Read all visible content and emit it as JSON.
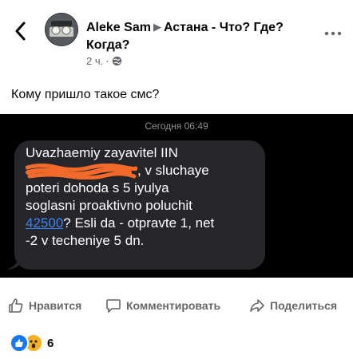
{
  "post": {
    "author": "Aleke Sam",
    "group": "Астана - Что? Где? Когда?",
    "time": "2 ч.",
    "dot": "·",
    "text": "Кому пришло такое смс?"
  },
  "sms": {
    "date": "Сегодня 06:49",
    "line1": "Uvazhaemiy zayavitel IIN",
    "line2_suffix": ", v sluchaye",
    "line3": "poteri dohoda s 5 iyulya",
    "line4": "soglasni proaktivno poluchit",
    "link_number": "42500",
    "line5_suffix": "? Esli da - otpravte 1, net",
    "line6": "-2 v techeniye 5 dn.",
    "redaction_color": "#f26a2a"
  },
  "actions": {
    "like": "Нравится",
    "comment": "Комментировать",
    "share": "Поделиться"
  },
  "reactions": {
    "count": "6",
    "types": [
      "like",
      "wow"
    ]
  },
  "icons": {
    "back": "chevron-left-icon",
    "more": "more-dots-icon",
    "globe": "globe-icon",
    "like": "thumbs-up-icon",
    "comment": "comment-icon",
    "share": "share-icon"
  },
  "colors": {
    "link": "#3b86f7",
    "bubble": "#26262a",
    "like_reaction": "#1877f2",
    "wow_reaction": "#f7b125",
    "secondary_text": "#65676b"
  }
}
